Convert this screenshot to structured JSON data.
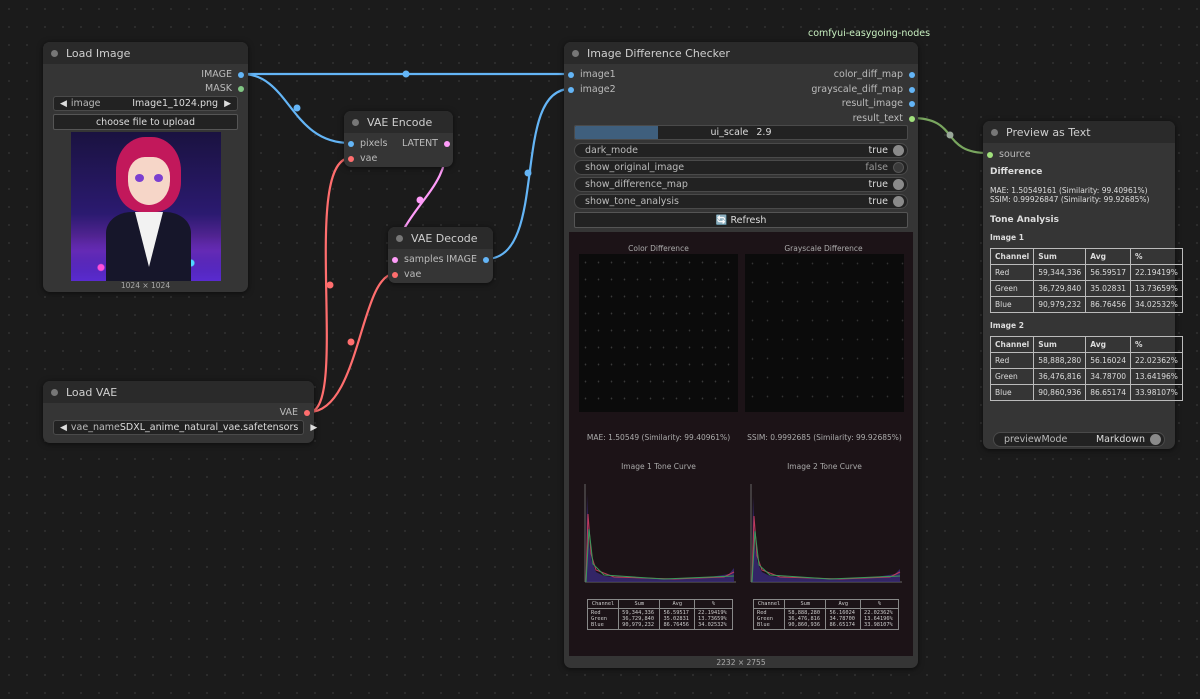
{
  "group_label": "comfyui-easygoing-nodes",
  "load_image": {
    "title": "Load Image",
    "outputs": [
      "IMAGE",
      "MASK"
    ],
    "image_widget": {
      "label": "image",
      "value": "Image1_1024.png"
    },
    "upload_label": "choose file to upload",
    "dims": "1024 × 1024"
  },
  "load_vae": {
    "title": "Load VAE",
    "output": "VAE",
    "widget": {
      "label": "vae_name",
      "value": "SDXL_anime_natural_vae.safetensors"
    }
  },
  "vae_encode": {
    "title": "VAE Encode",
    "inputs": [
      "pixels",
      "vae"
    ],
    "output": "LATENT"
  },
  "vae_decode": {
    "title": "VAE Decode",
    "inputs": [
      "samples",
      "vae"
    ],
    "output": "IMAGE"
  },
  "checker": {
    "title": "Image Difference Checker",
    "inputs": [
      "image1",
      "image2"
    ],
    "outputs": [
      "color_diff_map",
      "grayscale_diff_map",
      "result_image",
      "result_text"
    ],
    "ui_scale": {
      "label": "ui_scale",
      "value": "2.9",
      "fraction": 0.25
    },
    "toggles": [
      {
        "label": "dark_mode",
        "value": "true",
        "on": true
      },
      {
        "label": "show_original_image",
        "value": "false",
        "on": false
      },
      {
        "label": "show_difference_map",
        "value": "true",
        "on": true
      },
      {
        "label": "show_tone_analysis",
        "value": "true",
        "on": true
      }
    ],
    "refresh_icon": "refresh-icon",
    "refresh_label": "🔄 Refresh",
    "preview": {
      "color_title": "Color Difference",
      "gray_title": "Grayscale Difference",
      "mae_caption": "MAE: 1.50549 (Similarity: 99.40961%)",
      "ssim_caption": "SSIM: 0.9992685 (Similarity: 99.92685%)",
      "tone1_title": "Image 1 Tone Curve",
      "tone2_title": "Image 2 Tone Curve",
      "table_headers": [
        "Channel",
        "Sum",
        "Avg",
        "%"
      ],
      "table1_rows": [
        [
          "Red",
          "59,344,336",
          "56.59517",
          "22.19419%"
        ],
        [
          "Green",
          "36,729,840",
          "35.02831",
          "13.73659%"
        ],
        [
          "Blue",
          "90,979,232",
          "86.76456",
          "34.02532%"
        ]
      ],
      "table2_rows": [
        [
          "Red",
          "58,888,280",
          "56.16024",
          "22.02362%"
        ],
        [
          "Green",
          "36,476,816",
          "34.78700",
          "13.64196%"
        ],
        [
          "Blue",
          "90,860,936",
          "86.65174",
          "33.98107%"
        ]
      ]
    },
    "dims": "2232 × 2755"
  },
  "preview_text": {
    "title": "Preview as Text",
    "input": "source",
    "difference_heading": "Difference",
    "mae_line": "MAE: 1.50549161 (Similarity: 99.40961%)",
    "ssim_line": "SSIM: 0.99926847 (Similarity: 99.92685%)",
    "tone_heading": "Tone Analysis",
    "image1_heading": "Image 1",
    "image2_heading": "Image 2",
    "headers": [
      "Channel",
      "Sum",
      "Avg",
      "%"
    ],
    "image1_rows": [
      [
        "Red",
        "59,344,336",
        "56.59517",
        "22.19419%"
      ],
      [
        "Green",
        "36,729,840",
        "35.02831",
        "13.73659%"
      ],
      [
        "Blue",
        "90,979,232",
        "86.76456",
        "34.02532%"
      ]
    ],
    "image2_rows": [
      [
        "Red",
        "58,888,280",
        "56.16024",
        "22.02362%"
      ],
      [
        "Green",
        "36,476,816",
        "34.78700",
        "13.64196%"
      ],
      [
        "Blue",
        "90,860,936",
        "86.65174",
        "33.98107%"
      ]
    ],
    "preview_mode": {
      "label": "previewMode",
      "value": "Markdown"
    }
  },
  "colors": {
    "image": "#64b5f6",
    "mask": "#81c784",
    "vae": "#ff6e6e",
    "latent": "#ff9cf9",
    "string": "#a1e17c",
    "node_bg": "#353535",
    "title_bg": "#2a2a2a"
  }
}
